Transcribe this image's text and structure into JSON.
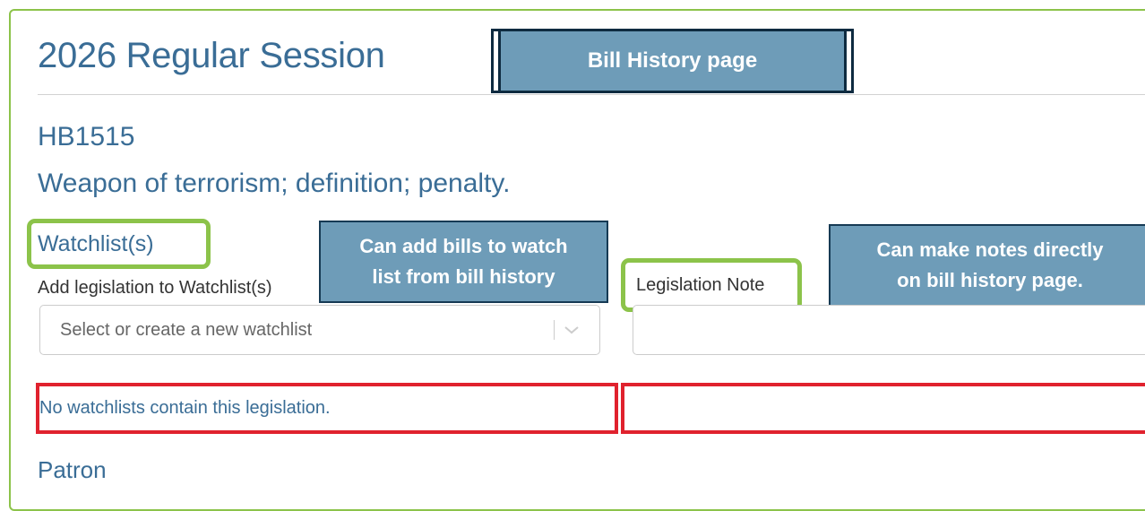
{
  "session": {
    "title": "2026 Regular Session"
  },
  "bill": {
    "number": "HB1515",
    "caption": "Weapon of terrorism; definition; penalty."
  },
  "watchlists": {
    "heading": "Watchlist(s)",
    "add_label": "Add legislation to Watchlist(s)",
    "select_placeholder": "Select or create a new watchlist",
    "status_text": "No watchlists contain this legislation."
  },
  "legislation_note": {
    "label": "Legislation Note",
    "value": ""
  },
  "patron": {
    "heading": "Patron"
  },
  "callouts": {
    "page": "Bill History page",
    "watchlist": [
      "Can add bills to watch",
      "list from bill history"
    ],
    "note": [
      "Can make notes directly",
      "on bill history page."
    ]
  },
  "colors": {
    "heading_blue": "#3a6d96",
    "callout_fill": "#6e9cb8",
    "highlight_green": "#8cc34a",
    "highlight_red": "#e0222e"
  },
  "icons": {
    "select_toggle": "chevron-down-icon"
  }
}
